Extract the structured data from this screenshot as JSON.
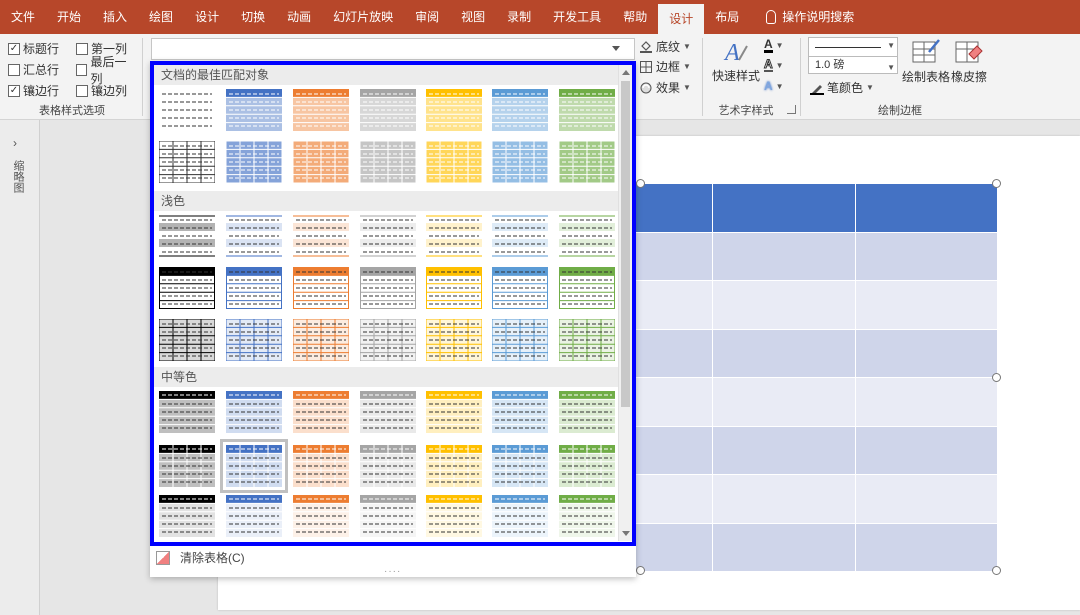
{
  "tabs": [
    {
      "label": "文件",
      "active": false
    },
    {
      "label": "开始",
      "active": false
    },
    {
      "label": "插入",
      "active": false
    },
    {
      "label": "绘图",
      "active": false
    },
    {
      "label": "设计",
      "active": false
    },
    {
      "label": "切换",
      "active": false
    },
    {
      "label": "动画",
      "active": false
    },
    {
      "label": "幻灯片放映",
      "active": false
    },
    {
      "label": "审阅",
      "active": false
    },
    {
      "label": "视图",
      "active": false
    },
    {
      "label": "录制",
      "active": false
    },
    {
      "label": "开发工具",
      "active": false
    },
    {
      "label": "帮助",
      "active": false
    },
    {
      "label": "设计",
      "active": true
    },
    {
      "label": "布局",
      "active": false
    }
  ],
  "tell_me": "操作说明搜索",
  "style_options": {
    "checkboxes": [
      {
        "label": "标题行",
        "checked": true
      },
      {
        "label": "第一列",
        "checked": false
      },
      {
        "label": "汇总行",
        "checked": false
      },
      {
        "label": "最后一列",
        "checked": false
      },
      {
        "label": "镶边行",
        "checked": true
      },
      {
        "label": "镶边列",
        "checked": false
      }
    ],
    "group_label": "表格样式选项"
  },
  "shading": {
    "shading_label": "底纹",
    "border_label": "边框",
    "effects_label": "效果"
  },
  "wordart": {
    "quick_styles_label": "快速样式",
    "group_label": "艺术字样式",
    "letter": "A"
  },
  "draw_borders": {
    "weight": "1.0 磅",
    "pen_color_label": "笔颜色",
    "draw_table_label": "绘制表格",
    "eraser_label": "橡皮擦",
    "group_label": "绘制边框"
  },
  "side_panel": {
    "label": "缩略图"
  },
  "gallery": {
    "sections": [
      "文档的最佳匹配对象",
      "浅色",
      "中等色"
    ],
    "clear_label": "清除表格(C)",
    "grip": "····"
  },
  "colors": {
    "accent": "#b7472a",
    "palette": [
      "#000000",
      "#4472c4",
      "#ed7d31",
      "#a5a5a5",
      "#ffc000",
      "#5b9bd5",
      "#70ad47"
    ],
    "table_header": "#4472c4",
    "table_band_dark": "#cfd5ea",
    "table_band_light": "#e9ebf5",
    "frame": "#0000ff"
  }
}
